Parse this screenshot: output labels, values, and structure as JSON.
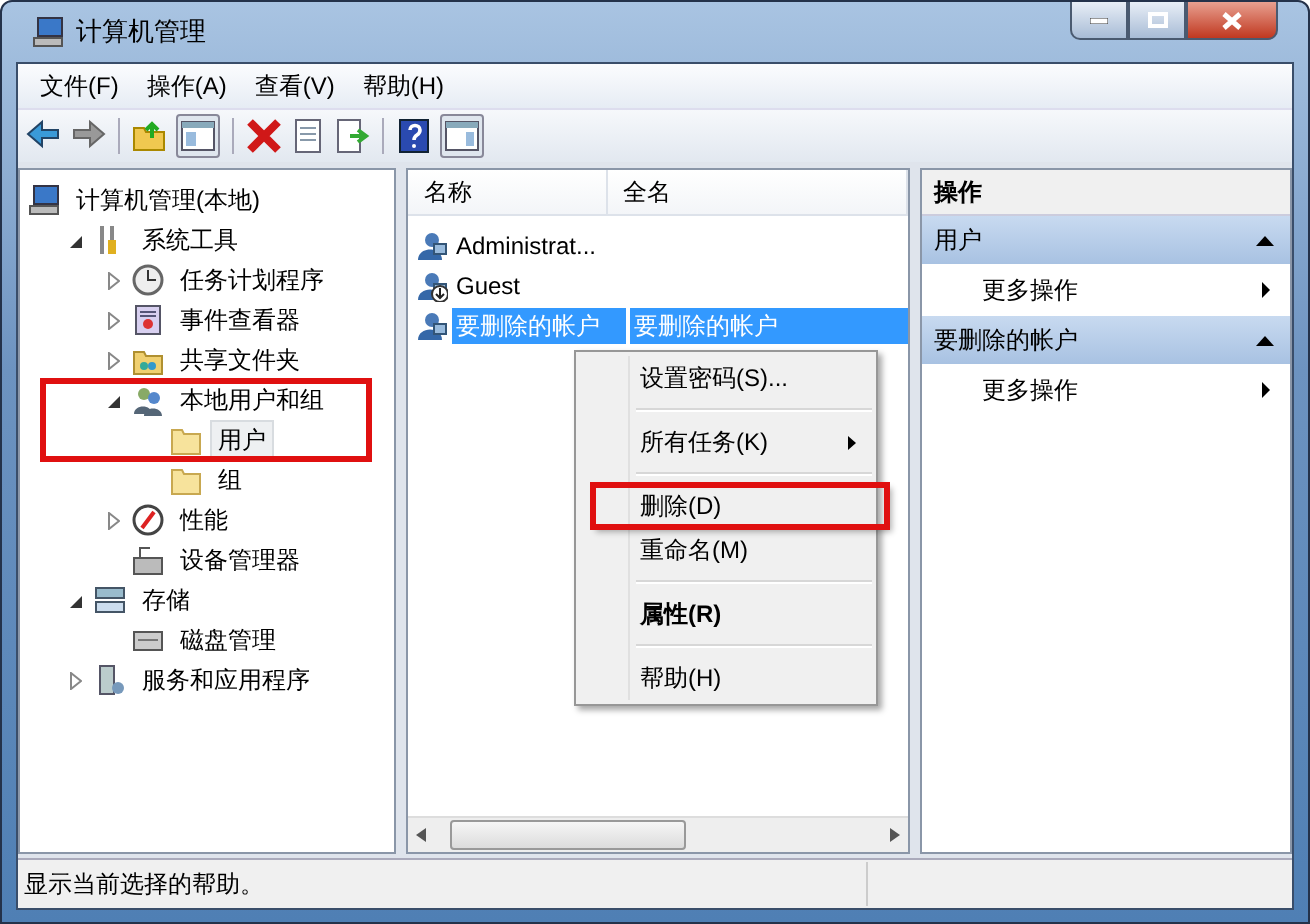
{
  "window": {
    "title": "计算机管理"
  },
  "menu": [
    "文件(F)",
    "操作(A)",
    "查看(V)",
    "帮助(H)"
  ],
  "tree": [
    {
      "label": "计算机管理(本地)",
      "kind": "computer",
      "selected": false,
      "highlighted": false,
      "children": [
        {
          "label": "系统工具",
          "kind": "tools",
          "expanded": true,
          "selected": false,
          "highlighted": false,
          "children": [
            {
              "label": "任务计划程序",
              "kind": "clock",
              "expanded": false,
              "selected": false,
              "highlighted": false
            },
            {
              "label": "事件查看器",
              "kind": "log",
              "expanded": false,
              "selected": false,
              "highlighted": false
            },
            {
              "label": "共享文件夹",
              "kind": "share",
              "expanded": false,
              "selected": false,
              "highlighted": false
            },
            {
              "label": "本地用户和组",
              "kind": "users",
              "expanded": true,
              "selected": false,
              "highlighted": true,
              "children": [
                {
                  "label": "用户",
                  "kind": "folder",
                  "selected": true,
                  "highlighted": true
                },
                {
                  "label": "组",
                  "kind": "folder",
                  "selected": false,
                  "highlighted": false
                }
              ]
            },
            {
              "label": "性能",
              "kind": "perf",
              "expanded": false,
              "selected": false,
              "highlighted": false
            },
            {
              "label": "设备管理器",
              "kind": "device",
              "selected": false,
              "highlighted": false
            }
          ]
        },
        {
          "label": "存储",
          "kind": "storage",
          "expanded": true,
          "selected": false,
          "highlighted": false,
          "children": [
            {
              "label": "磁盘管理",
              "kind": "disk",
              "selected": false,
              "highlighted": false
            }
          ]
        },
        {
          "label": "服务和应用程序",
          "kind": "services",
          "expanded": false,
          "selected": false,
          "highlighted": false
        }
      ]
    }
  ],
  "list": {
    "columns": [
      "名称",
      "全名"
    ],
    "rows": [
      {
        "name": "Administrat...",
        "disabled": false,
        "selected": false
      },
      {
        "name": "Guest",
        "disabled": true,
        "selected": false
      },
      {
        "name": "要删除的帐户",
        "full_name": "要删除的帐户",
        "disabled": false,
        "selected": true
      }
    ]
  },
  "context_menu": [
    {
      "kind": "item",
      "label": "设置密码(S)...",
      "submenu": false,
      "default": false,
      "highlighted": false
    },
    {
      "kind": "separator"
    },
    {
      "kind": "item",
      "label": "所有任务(K)",
      "submenu": true,
      "default": false,
      "highlighted": false
    },
    {
      "kind": "separator"
    },
    {
      "kind": "item",
      "label": "删除(D)",
      "submenu": false,
      "default": false,
      "highlighted": true
    },
    {
      "kind": "item",
      "label": "重命名(M)",
      "submenu": false,
      "default": false,
      "highlighted": false
    },
    {
      "kind": "separator"
    },
    {
      "kind": "item",
      "label": "属性(R)",
      "submenu": false,
      "default": true,
      "highlighted": false
    },
    {
      "kind": "separator"
    },
    {
      "kind": "item",
      "label": "帮助(H)",
      "submenu": false,
      "default": false,
      "highlighted": false
    }
  ],
  "actions": {
    "title": "操作",
    "sections": [
      {
        "title": "用户",
        "expanded": true,
        "items": [
          {
            "label": "更多操作",
            "submenu": true
          }
        ]
      },
      {
        "title": "要删除的帐户",
        "expanded": true,
        "items": [
          {
            "label": "更多操作",
            "submenu": true
          }
        ]
      }
    ]
  },
  "status_bar": "显示当前选择的帮助。"
}
